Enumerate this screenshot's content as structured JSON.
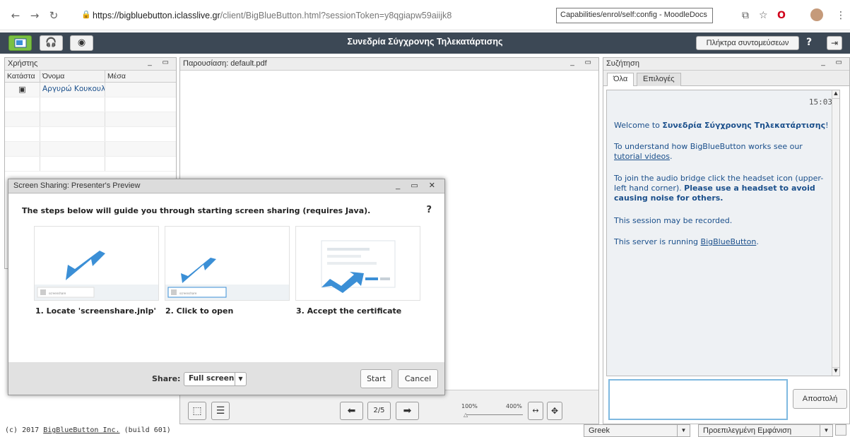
{
  "browser": {
    "url_main": "https://bigbluebutton.iclasslive.gr",
    "url_rest": "/client/BigBlueButton.html?sessionToken=y8qgiapw59aiijk8",
    "tooltip": "Capabilities/enrol/self:config - MoodleDocs"
  },
  "app": {
    "title": "Συνεδρία Σύγχρονης Τηλεκατάρτισης",
    "shortcuts_label": "Πλήκτρα συντομεύσεων",
    "help_label": "?"
  },
  "users": {
    "title": "Χρήστης",
    "columns": [
      "Κατάστα",
      "Όνομα",
      "Μέσα"
    ],
    "rows": [
      {
        "name": "Αργυρώ Κουκουλά"
      }
    ]
  },
  "presentation": {
    "title": "Παρουσίαση: default.pdf",
    "page": "2/5",
    "zoom_min": "100%",
    "zoom_max": "400%"
  },
  "chat": {
    "title": "Συζήτηση",
    "tabs": [
      "Όλα",
      "Επιλογές"
    ],
    "time": "15:03",
    "welcome_prefix": "Welcome to ",
    "welcome_bold": "Συνεδρία Σύγχρονης Τηλεκατάρτισης",
    "welcome_suffix": "!",
    "tutorial_prefix": "To understand how BigBlueButton works see our ",
    "tutorial_link": "tutorial videos",
    "tutorial_suffix": ".",
    "audio_text": "To join the audio bridge click the headset icon (upper-left hand corner). ",
    "audio_bold": "Please use a headset to avoid causing noise for others.",
    "recorded": "This session may be recorded.",
    "server_prefix": "This server is running ",
    "server_link": "BigBlueButton",
    "server_suffix": ".",
    "send_label": "Αποστολή"
  },
  "dialog": {
    "title": "Screen Sharing: Presenter's Preview",
    "intro": "The steps below will guide you through starting screen sharing (requires Java).",
    "help": "?",
    "steps": [
      "1. Locate 'screenshare.jnlp'",
      "2. Click to open",
      "3. Accept the certificate"
    ],
    "step_file_label": "screenshare",
    "share_label": "Share:",
    "share_value": "Full screen",
    "start_label": "Start",
    "cancel_label": "Cancel"
  },
  "footer": {
    "copyright_prefix": "(c) 2017 ",
    "copyright_link": "BigBlueButton Inc.",
    "copyright_suffix": " (build 601)",
    "language": "Greek",
    "layout": "Προεπιλεγμένη Εμφάνιση"
  },
  "colors": {
    "toolbar": "#3c4855",
    "link": "#1a4f8b",
    "accent_blue": "#3b8fd6"
  }
}
